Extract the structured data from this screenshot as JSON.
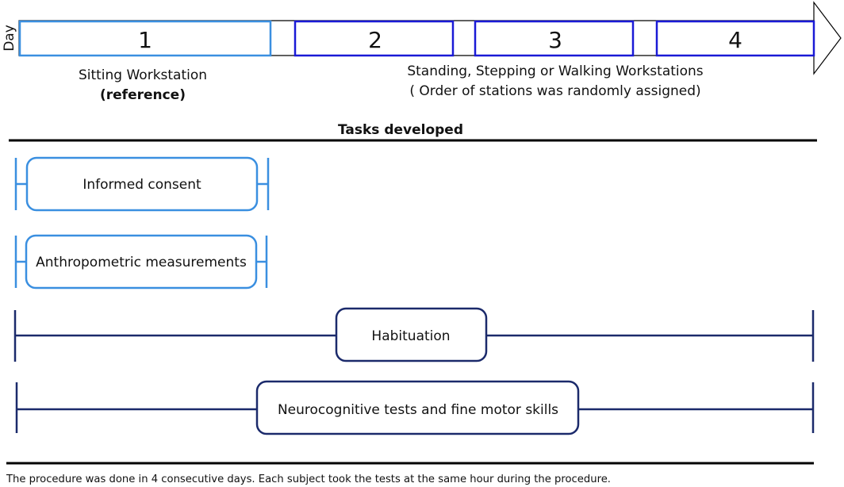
{
  "axis_label": "Day",
  "days": [
    {
      "label": "1",
      "kind": "reference"
    },
    {
      "label": "2",
      "kind": "experimental"
    },
    {
      "label": "3",
      "kind": "experimental"
    },
    {
      "label": "4",
      "kind": "experimental"
    }
  ],
  "sitting": {
    "line1": "Sitting Workstation",
    "line2": "(reference)"
  },
  "standing": {
    "line1": "Standing, Stepping or Walking Workstations",
    "line2": "( Order of stations was randomly assigned)"
  },
  "tasks_header": "Tasks developed",
  "tasks": [
    {
      "label": "Informed consent",
      "days": [
        1
      ],
      "color": "#3a8fe0"
    },
    {
      "label": "Anthropometric measurements",
      "days": [
        1
      ],
      "color": "#3a8fe0"
    },
    {
      "label": "Habituation",
      "days": [
        1,
        2,
        3,
        4
      ],
      "color": "#1b2a6b"
    },
    {
      "label": "Neurocognitive tests and fine motor skills",
      "days": [
        1,
        2,
        3,
        4
      ],
      "color": "#1b2a6b"
    }
  ],
  "footnote": "The procedure was done in 4 consecutive days. Each subject took the tests at the same hour during the procedure.",
  "colors": {
    "day1_border": "#3a8fe0",
    "day_border": "#1a1ad6",
    "dark_navy": "#1b2a6b",
    "rule": "#000000"
  }
}
